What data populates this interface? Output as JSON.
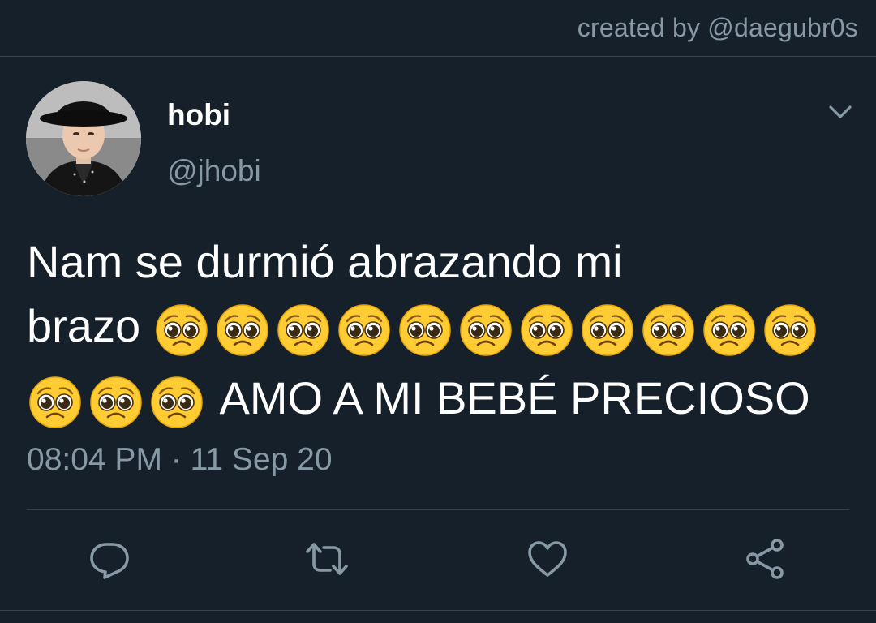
{
  "credit": "created by @daegubr0s",
  "tweet": {
    "author": {
      "display_name": "hobi",
      "handle": "@jhobi",
      "avatar_icon": "profile-photo"
    },
    "text_line_1": "Nam se durmió abrazando mi",
    "text_line_2": "brazo",
    "text_line_3": "AMO A MI BEBÉ PRECIOSO",
    "emoji": "pleading-face",
    "emoji_count_line_2": 11,
    "emoji_count_line_3": 3,
    "timestamp": "08:04 PM · 11 Sep 20"
  },
  "actions": [
    {
      "name": "reply",
      "icon": "reply-icon"
    },
    {
      "name": "retweet",
      "icon": "retweet-icon"
    },
    {
      "name": "like",
      "icon": "heart-icon"
    },
    {
      "name": "share",
      "icon": "share-icon"
    }
  ],
  "colors": {
    "background": "#15202b",
    "secondary_text": "#8899a6",
    "divider": "#38444d",
    "primary_text": "#ffffff"
  }
}
